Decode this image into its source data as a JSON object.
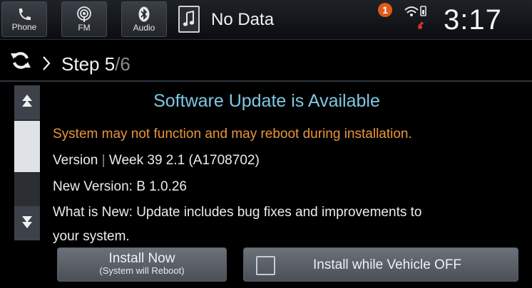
{
  "topbar": {
    "phone_label": "Phone",
    "fm_label": "FM",
    "audio_label": "Audio",
    "now_playing": "No Data",
    "alert_count": "1",
    "clock": "3:17"
  },
  "step": {
    "label": "Step 5",
    "total": "/6"
  },
  "content": {
    "title": "Software Update is Available",
    "warning": "System may not function and may reboot during installation.",
    "version_label": "Version",
    "version_sep": "|",
    "version_value": "Week 39 2.1 (A1708702)",
    "new_version": "New Version:  B 1.0.26",
    "whats_new_line1": "What is New: Update includes bug fixes and improvements to",
    "whats_new_line2": "your system."
  },
  "buttons": {
    "install_now": "Install Now",
    "install_now_sub": "(System will Reboot)",
    "install_off": "Install while Vehicle OFF",
    "install_off_checked": false
  },
  "colors": {
    "title": "#7ec8e3",
    "warning": "#e9953a",
    "alert_badge": "#e05a1a"
  },
  "icons": [
    "phone-icon",
    "radio-icon",
    "bluetooth-icon",
    "music-note-icon",
    "wifi-icon",
    "refresh-icon",
    "chevron-right-icon",
    "scroll-up-icon",
    "scroll-down-icon"
  ]
}
